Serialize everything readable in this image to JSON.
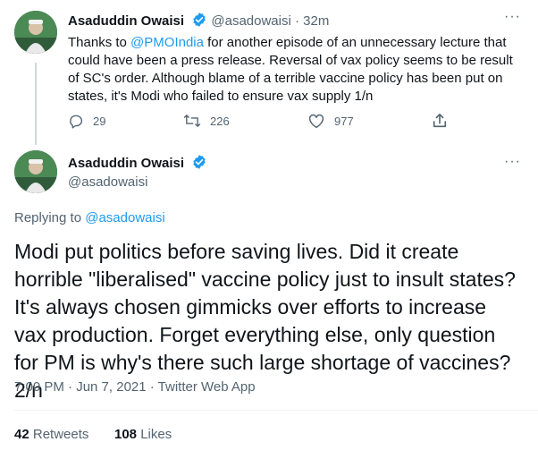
{
  "tweet1": {
    "name": "Asaduddin Owaisi",
    "handle": "@asadowaisi",
    "separator": "·",
    "time": "32m",
    "more": "···",
    "text_before": "Thanks to ",
    "mention": "@PMOIndia",
    "text_after": " for another episode of an unnecessary lecture that could have been a press release. Reversal of vax policy seems to be result of SC's order. Although blame of a terrible vaccine policy has been put on states, it's Modi who failed to ensure vax supply 1/n",
    "replies": "29",
    "retweets": "226",
    "likes": "977"
  },
  "tweet2": {
    "name": "Asaduddin Owaisi",
    "handle": "@asadowaisi",
    "more": "···",
    "replying_prefix": "Replying to ",
    "replying_to": "@asadowaisi",
    "text": "Modi put politics before saving lives. Did it create horrible \"liberalised\" vaccine policy just to insult states? It's always chosen gimmicks over efforts to increase vax production. Forget everything else, only question for PM is why's there such large shortage of vaccines? 2/n",
    "meta": "7:00 PM · Jun 7, 2021 · Twitter Web App",
    "retweets_count": "42",
    "retweets_label": "Retweets",
    "likes_count": "108",
    "likes_label": "Likes"
  },
  "colors": {
    "link": "#1d9bf0",
    "muted": "#536471",
    "verified": "#1d9bf0"
  }
}
